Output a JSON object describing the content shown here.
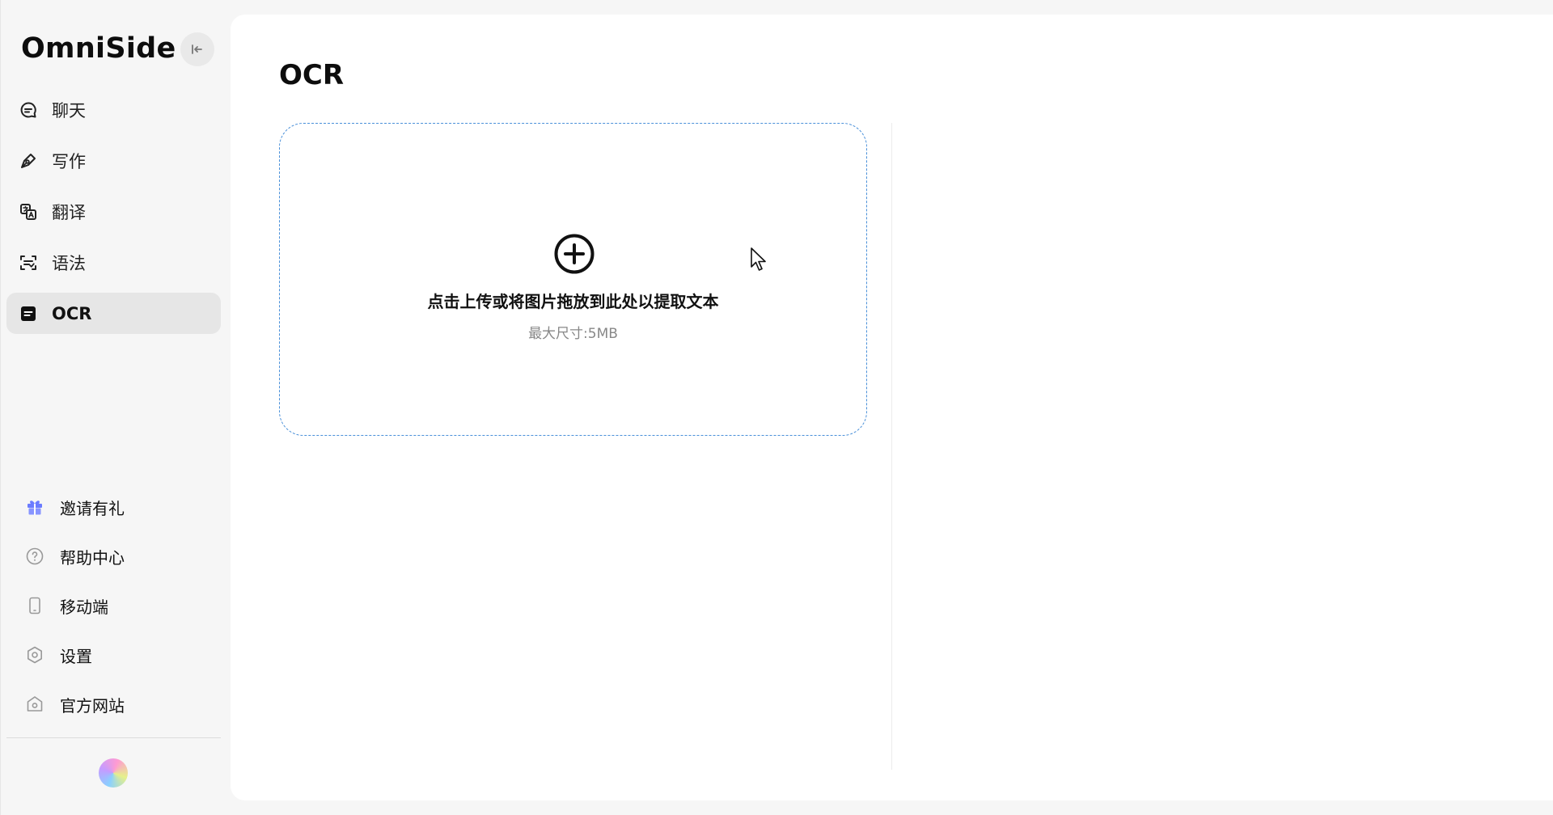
{
  "brand": {
    "name": "OmniSide"
  },
  "sidebar": {
    "collapse_icon": "collapse-left-icon",
    "items": [
      {
        "label": "聊天",
        "icon": "chat-icon",
        "active": false
      },
      {
        "label": "写作",
        "icon": "pen-icon",
        "active": false
      },
      {
        "label": "翻译",
        "icon": "translate-icon",
        "active": false
      },
      {
        "label": "语法",
        "icon": "grammar-scan-icon",
        "active": false
      },
      {
        "label": "OCR",
        "icon": "ocr-doc-icon",
        "active": true
      }
    ],
    "bottom_items": [
      {
        "label": "邀请有礼",
        "icon": "gift-icon"
      },
      {
        "label": "帮助中心",
        "icon": "help-icon"
      },
      {
        "label": "移动端",
        "icon": "mobile-icon"
      },
      {
        "label": "设置",
        "icon": "settings-icon"
      },
      {
        "label": "官方网站",
        "icon": "website-icon"
      }
    ]
  },
  "main": {
    "title": "OCR",
    "dropzone": {
      "icon": "plus-circle-icon",
      "text": "点击上传或将图片拖放到此处以提取文本",
      "subtext": "最大尺寸:5MB"
    }
  },
  "colors": {
    "accent_dashed": "#4a90d9",
    "gift": "#6b7cff",
    "active_bg": "#e6e6e6"
  }
}
